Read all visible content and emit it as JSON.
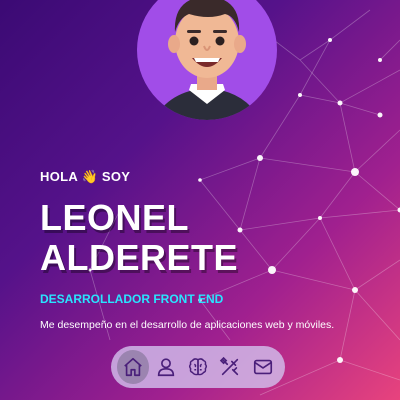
{
  "hero": {
    "greeting": "HOLA 👋 SOY",
    "name_line1": "LEONEL",
    "name_line2": "ALDERETE",
    "role": "DESARROLLADOR FRONT END",
    "description": "Me desempeño en el desarrollo de aplicaciones web y móviles."
  },
  "colors": {
    "background_start": "#3b0a74",
    "background_end": "#e8437d",
    "accent": "#29e5ff",
    "avatar_bg": "#a14de8",
    "dock_icon": "#4a1f7a"
  },
  "nav": {
    "items": [
      {
        "icon": "home-icon",
        "active": true
      },
      {
        "icon": "user-icon",
        "active": false
      },
      {
        "icon": "brain-icon",
        "active": false
      },
      {
        "icon": "tools-icon",
        "active": false
      },
      {
        "icon": "mail-icon",
        "active": false
      }
    ]
  }
}
